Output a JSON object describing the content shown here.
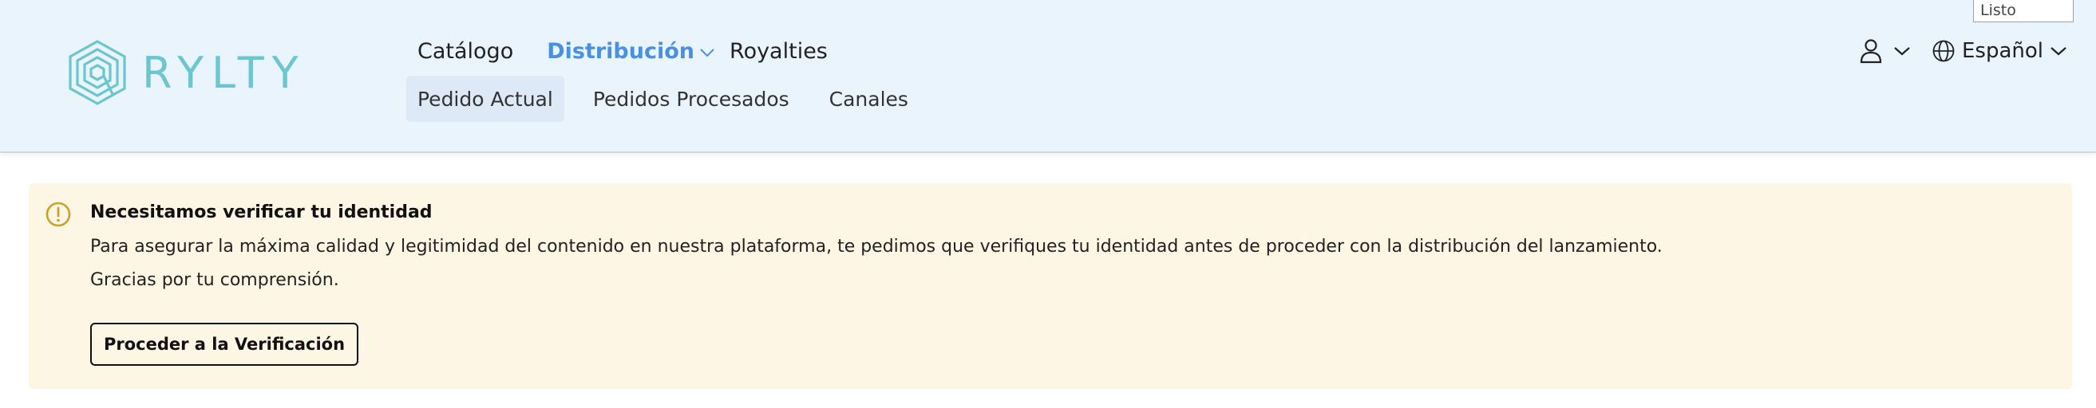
{
  "window": {
    "status_label": "Listo"
  },
  "brand": {
    "name": "RYLTY",
    "color": "#6cc6d0"
  },
  "nav": {
    "items": [
      {
        "label": "Catálogo",
        "active": false
      },
      {
        "label": "Distribución",
        "active": true,
        "has_dropdown": true
      },
      {
        "label": "Royalties",
        "active": false
      }
    ],
    "sub_items": [
      {
        "label": "Pedido Actual",
        "active": true
      },
      {
        "label": "Pedidos Procesados",
        "active": false
      },
      {
        "label": "Canales",
        "active": false
      }
    ],
    "accent_color": "#4a90e2"
  },
  "header_right": {
    "user_icon": "user-icon",
    "language_icon": "globe-icon",
    "language_label": "Español"
  },
  "alert": {
    "icon": "warning-circle-icon",
    "title": "Necesitamos verificar tu identidad",
    "body": "Para asegurar la máxima calidad y legitimidad del contenido en nuestra plataforma, te pedimos que verifiques tu identidad antes de proceder con la distribución del lanzamiento.",
    "body_secondary": "Gracias por tu comprensión.",
    "button_label": "Proceder a la Verificación",
    "background": "#fdf6e4",
    "icon_color": "#c9a227"
  }
}
